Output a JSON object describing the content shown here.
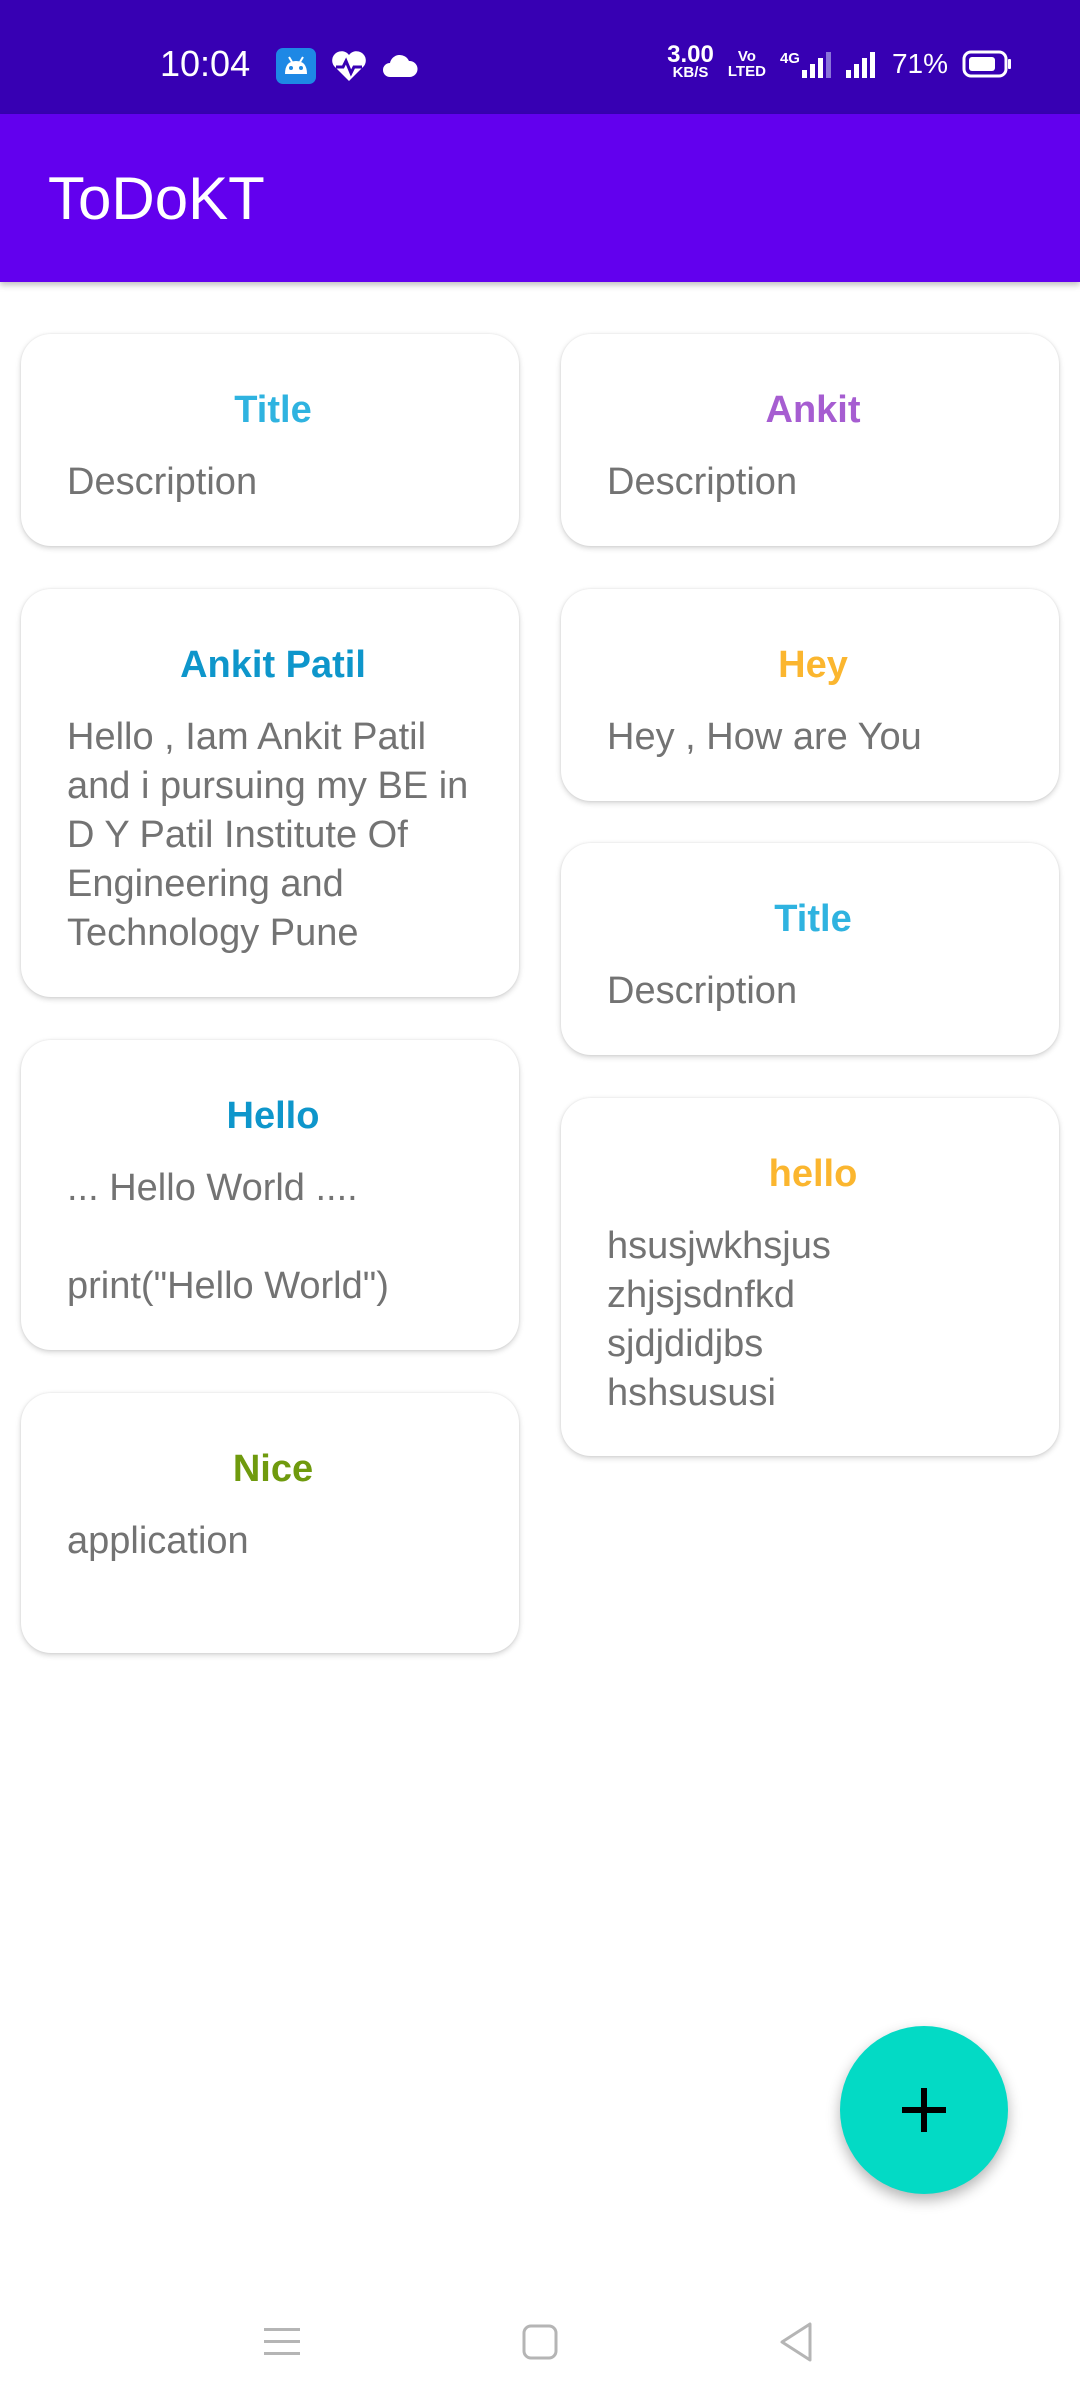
{
  "status_bar": {
    "time": "10:04",
    "net_speed_value": "3.00",
    "net_speed_unit": "KB/S",
    "volte_top": "Vo",
    "volte_bottom": "LTED",
    "network_type": "4G",
    "battery_percent": "71%"
  },
  "app_bar": {
    "title": "ToDoKT"
  },
  "notes": [
    {
      "title": "Title",
      "description": "Description",
      "title_color": "#2fb3e0"
    },
    {
      "title": "Ankit",
      "description": "Description",
      "title_color": "#a65dd1"
    },
    {
      "title": "Ankit Patil",
      "description": "Hello , Iam Ankit Patil and i pursuing my BE in D Y Patil Institute Of Engineering and Technology Pune",
      "title_color": "#0e96cb"
    },
    {
      "title": "Hey",
      "description": "Hey , How are You",
      "title_color": "#fbb62f"
    },
    {
      "title": "Title",
      "description": "Description",
      "title_color": "#2fb3e0"
    },
    {
      "title": "Hello",
      "description": "... Hello World ....\n\nprint(\"Hello World\")",
      "title_color": "#0e96cb"
    },
    {
      "title": "hello",
      "description": "hsusjwkhsjus\nzhjsjsdnfkd\nsjdjdidjbs\nhshsususi",
      "title_color": "#fbb62f"
    },
    {
      "title": "Nice",
      "description": "application",
      "title_color": "#6f9a0e"
    }
  ],
  "fab": {
    "icon": "plus-icon",
    "color": "#03dac5"
  },
  "nav_bar": {
    "icons": [
      "menu-icon",
      "home-icon",
      "back-icon"
    ]
  },
  "colors": {
    "status_bar": "#3700b3",
    "app_bar": "#6200ee",
    "description_text": "#737373"
  }
}
